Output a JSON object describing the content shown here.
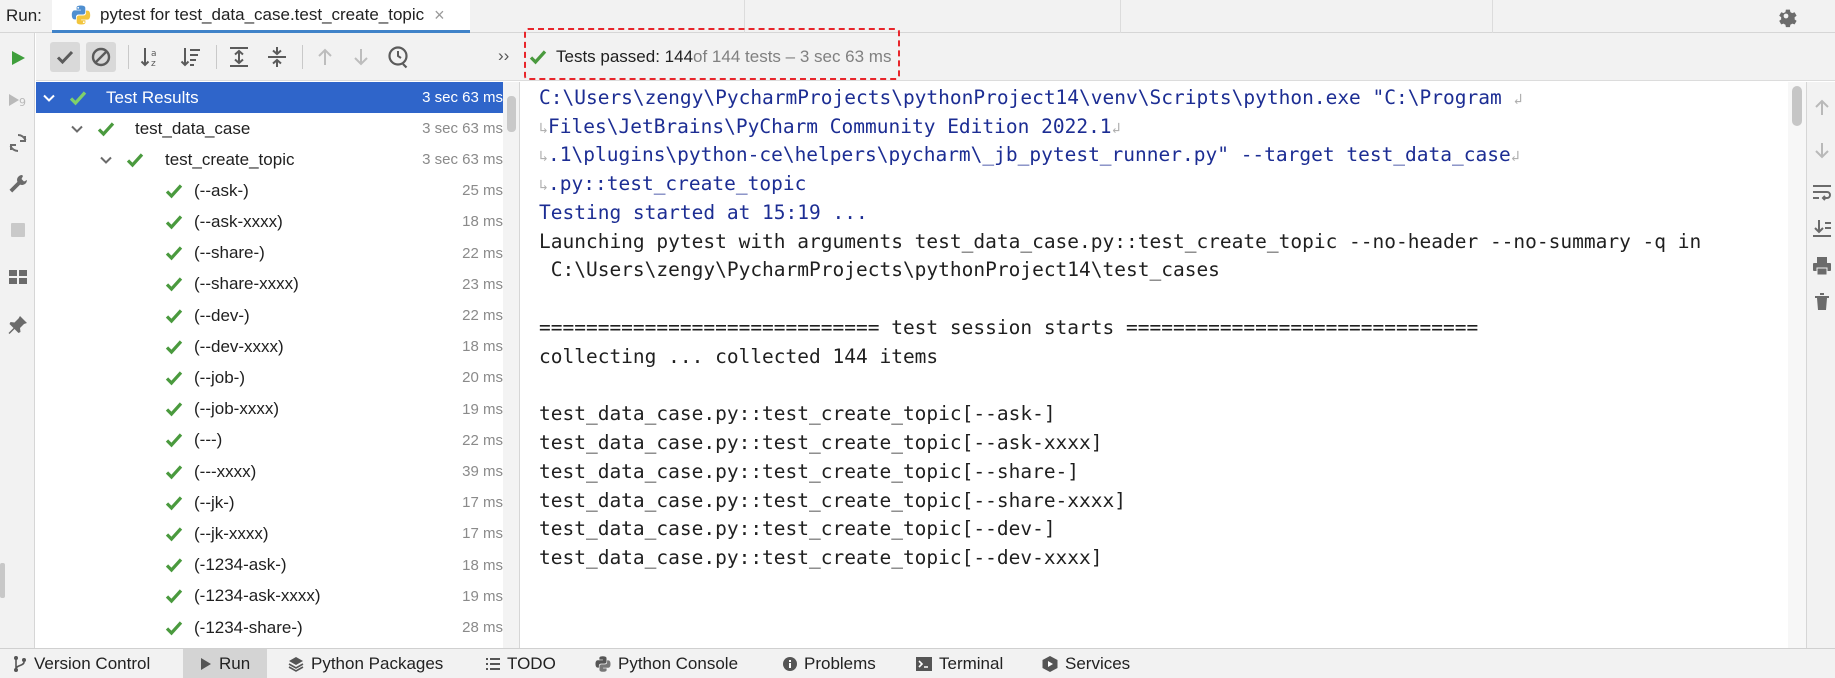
{
  "top_bar": {
    "run_label": "Run:",
    "tab_title": "pytest for test_data_case.test_create_topic",
    "tab_close": "×",
    "icons": [
      "python-icon",
      "close-icon",
      "gear-icon"
    ]
  },
  "status": {
    "passed_label": "Tests passed: 144",
    "passed_rest": " of 144 tests – 3 sec 63 ms"
  },
  "toolbar": {
    "more": "››",
    "icons": [
      "rerun-play-icon",
      "show-passed-check-icon",
      "show-ignored-icon",
      "sort-alpha-icon",
      "sort-duration-icon",
      "expand-all-icon",
      "collapse-all-icon",
      "prev-failed-up-icon",
      "next-failed-down-icon",
      "history-clock-icon"
    ]
  },
  "tree": {
    "rows": [
      {
        "name": "Test Results",
        "duration": "3 sec 63 ms"
      },
      {
        "name": "test_data_case",
        "duration": "3 sec 63 ms"
      },
      {
        "name": "test_create_topic",
        "duration": "3 sec 63 ms"
      },
      {
        "name": "(--ask-)",
        "duration": "25 ms"
      },
      {
        "name": "(--ask-xxxx)",
        "duration": "18 ms"
      },
      {
        "name": "(--share-)",
        "duration": "22 ms"
      },
      {
        "name": "(--share-xxxx)",
        "duration": "23 ms"
      },
      {
        "name": "(--dev-)",
        "duration": "22 ms"
      },
      {
        "name": "(--dev-xxxx)",
        "duration": "18 ms"
      },
      {
        "name": "(--job-)",
        "duration": "20 ms"
      },
      {
        "name": "(--job-xxxx)",
        "duration": "19 ms"
      },
      {
        "name": "(---)",
        "duration": "22 ms"
      },
      {
        "name": "(---xxxx)",
        "duration": "39 ms"
      },
      {
        "name": "(--jk-)",
        "duration": "17 ms"
      },
      {
        "name": "(--jk-xxxx)",
        "duration": "17 ms"
      },
      {
        "name": "(-1234-ask-)",
        "duration": "18 ms"
      },
      {
        "name": "(-1234-ask-xxxx)",
        "duration": "19 ms"
      },
      {
        "name": "(-1234-share-)",
        "duration": "28 ms"
      }
    ]
  },
  "console": {
    "wrap_mark": "↲",
    "lead_mark": "↳",
    "lines": [
      "C:\\Users\\zengy\\PycharmProjects\\pythonProject14\\venv\\Scripts\\python.exe \"C:\\Program",
      "Files\\JetBrains\\PyCharm Community Edition 2022.1",
      ".1\\plugins\\python-ce\\helpers\\pycharm\\_jb_pytest_runner.py\" --target test_data_case",
      ".py::test_create_topic",
      "Testing started at 15:19 ...",
      "Launching pytest with arguments test_data_case.py::test_create_topic --no-header --no-summary -q in",
      " C:\\Users\\zengy\\PycharmProjects\\pythonProject14\\test_cases",
      "",
      "============================= test session starts ==============================",
      "collecting ... collected 144 items",
      "",
      "test_data_case.py::test_create_topic[--ask-]",
      "test_data_case.py::test_create_topic[--ask-xxxx]",
      "test_data_case.py::test_create_topic[--share-]",
      "test_data_case.py::test_create_topic[--share-xxxx]",
      "test_data_case.py::test_create_topic[--dev-]",
      "test_data_case.py::test_create_topic[--dev-xxxx]"
    ]
  },
  "bottom_bar": {
    "tabs": [
      {
        "label": "Version Control",
        "icon": "vcs-branch-icon"
      },
      {
        "label": "Run",
        "icon": "run-play-icon"
      },
      {
        "label": "Python Packages",
        "icon": "layers-icon"
      },
      {
        "label": "TODO",
        "icon": "list-icon"
      },
      {
        "label": "Python Console",
        "icon": "python-icon"
      },
      {
        "label": "Problems",
        "icon": "info-icon"
      },
      {
        "label": "Terminal",
        "icon": "terminal-icon"
      },
      {
        "label": "Services",
        "icon": "services-play-icon"
      }
    ]
  },
  "colors": {
    "selection": "#2f65ca",
    "pass_green": "#4a9a3e",
    "console_blue": "#1c2d93",
    "highlight_dash": "#e8262b"
  }
}
